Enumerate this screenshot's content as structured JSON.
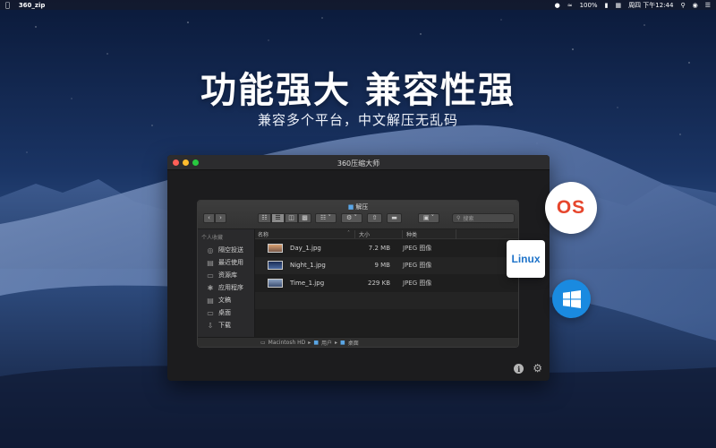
{
  "menubar": {
    "app_name": "360_zip",
    "battery": "100%",
    "datetime": "周四 下午12:44"
  },
  "hero": {
    "title": "功能强大 兼容性强",
    "subtitle": "兼容多个平台，中文解压无乱码"
  },
  "window": {
    "title": "360压缩大师"
  },
  "finder": {
    "title": "解压",
    "search_placeholder": "搜索",
    "sidebar_header": "个人收藏",
    "sidebar_items": [
      {
        "label": "隔空投送",
        "icon": "airdrop-icon"
      },
      {
        "label": "最近使用",
        "icon": "recents-icon"
      },
      {
        "label": "资源库",
        "icon": "library-icon"
      },
      {
        "label": "应用程序",
        "icon": "applications-icon"
      },
      {
        "label": "文稿",
        "icon": "documents-icon"
      },
      {
        "label": "桌面",
        "icon": "desktop-icon"
      },
      {
        "label": "下载",
        "icon": "downloads-icon"
      }
    ],
    "columns": {
      "name": "名称",
      "size": "大小",
      "kind": "种类"
    },
    "files": [
      {
        "name": "Day_1.jpg",
        "size": "7.2 MB",
        "kind": "JPEG 图像"
      },
      {
        "name": "Night_1.jpg",
        "size": "9 MB",
        "kind": "JPEG 图像"
      },
      {
        "name": "Time_1.jpg",
        "size": "229 KB",
        "kind": "JPEG 图像"
      }
    ],
    "path": [
      "Macintosh HD",
      "用户",
      "桌面"
    ]
  },
  "badges": {
    "os": "OS",
    "linux": "Linux"
  },
  "colors": {
    "accent_blue": "#1a8ae0",
    "os_orange": "#e6462d",
    "folder_blue": "#5aa6e6"
  }
}
